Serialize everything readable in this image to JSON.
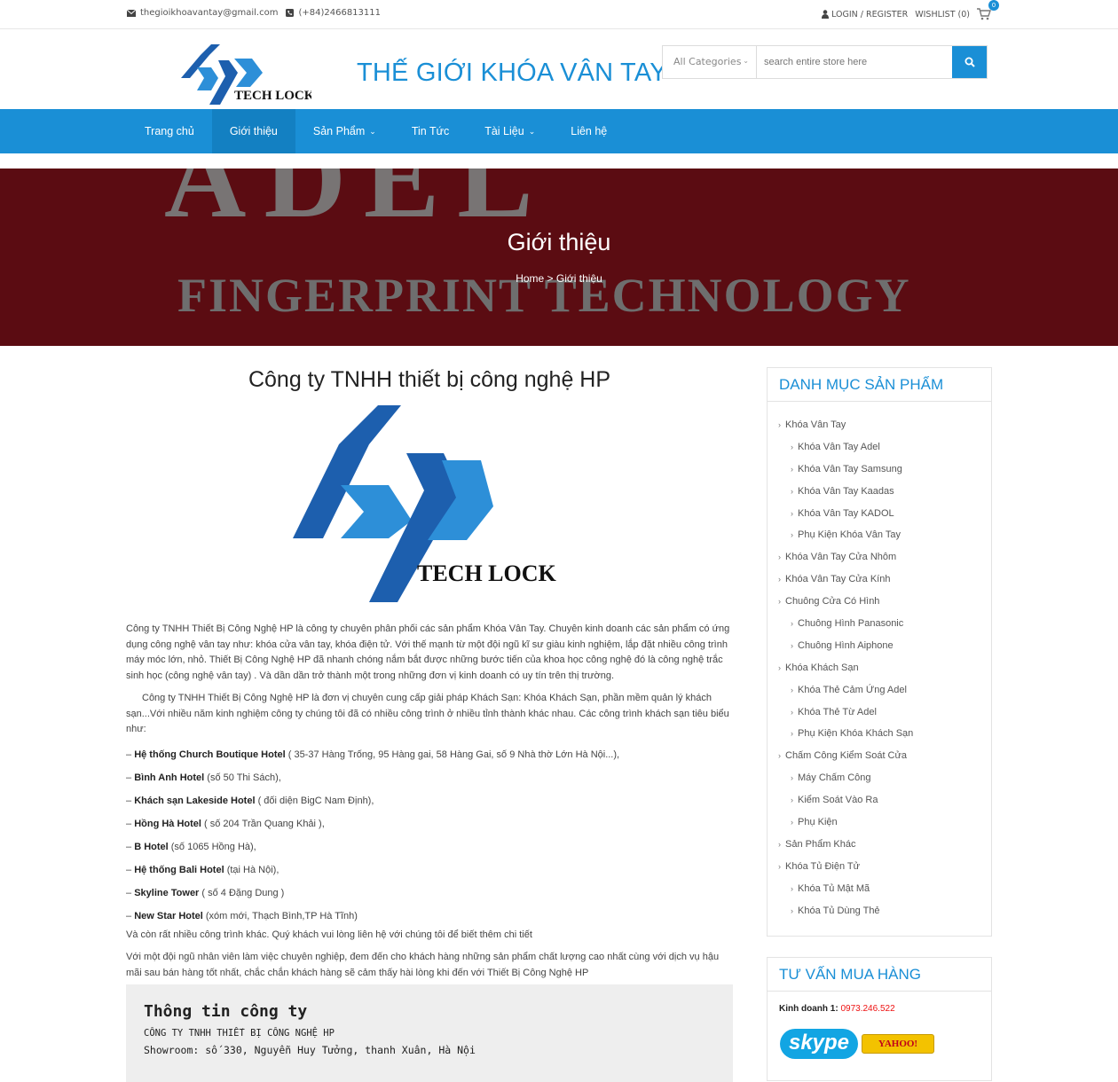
{
  "topbar": {
    "email": "thegioikhoavantay@gmail.com",
    "phone": "(+84)2466813111",
    "login": "LOGIN / REGISTER",
    "wishlist": "WISHLIST (0)",
    "cart_count": "0"
  },
  "header": {
    "logo_text": "TECH LOCK",
    "site_title": "THẾ GIỚI KHÓA VÂN TAY",
    "search_category": "All Categories",
    "search_placeholder": "search entire store here"
  },
  "nav": {
    "items": [
      "Trang chủ",
      "Giới thiệu",
      "Sản Phẩm",
      "Tin Tức",
      "Tài Liệu",
      "Liên hệ"
    ]
  },
  "banner": {
    "bg_text_1": "ADEL",
    "bg_text_2": "FINGERPRINT TECHNOLOGY",
    "title": "Giới thiệu",
    "crumb_home": "Home",
    "crumb_sep": " > ",
    "crumb_current": "Giới thiệu"
  },
  "content": {
    "heading": "Công ty TNHH thiết bị công nghệ HP",
    "logo_text": "TECH LOCK",
    "para1": "Công ty TNHH Thiết Bị Công Nghệ HP là công ty chuyên phân phối các sản phẩm Khóa Vân Tay. Chuyên kinh doanh các sản phẩm có ứng dụng công nghệ vân tay như: khóa cửa vân tay, khóa điện tử. Với thế mạnh từ một đội ngũ kĩ sư giàu kinh nghiệm, lắp đặt nhiều công trình máy móc lớn, nhỏ. Thiết Bị Công Nghệ HP đã nhanh chóng nắm bắt được những bước tiến của khoa học công nghệ đó là công nghệ trắc sinh học (công nghệ vân tay) . Và dần dần trở thành một trong những đơn vị kinh doanh có uy tín trên thị trường.",
    "para2": "Công ty TNHH Thiết Bị Công Nghệ HP là đơn vị chuyên cung cấp giải pháp Khách Sạn: Khóa Khách Sạn, phần mềm quản lý khách sạn...Với nhiều năm kinh nghiệm công ty chúng tôi đã có nhiều công trình ở nhiều tỉnh thành khác nhau. Các công trình khách sạn tiêu biểu như:",
    "hotels": [
      {
        "name": "Hệ thống Church Boutique Hotel",
        "detail": " ( 35-37 Hàng Trống, 95 Hàng gai, 58 Hàng Gai, số 9 Nhà thờ Lớn Hà Nội...),"
      },
      {
        "name": "Bình Anh Hotel",
        "detail": " (số 50 Thi Sách),"
      },
      {
        "name": "Khách sạn Lakeside Hotel",
        "detail": " ( đối diện BigC Nam Định),"
      },
      {
        "name": "Hồng Hà Hotel",
        "detail": " ( số 204 Trần Quang Khải ),"
      },
      {
        "name": "B Hotel",
        "detail": " (số 1065 Hồng Hà),"
      },
      {
        "name": "Hệ thống Bali Hotel",
        "detail": " (tại Hà Nội),"
      },
      {
        "name": "Skyline Tower",
        "detail": " ( số 4 Đặng Dung )"
      },
      {
        "name": "New Star Hotel",
        "detail": " (xóm mới, Thạch Bình,TP Hà Tĩnh)"
      }
    ],
    "para3": "Và còn rất nhiều công trình khác. Quý khách vui lòng liên hệ với chúng tôi để biết thêm chi tiết",
    "para4": "Với một đội ngũ nhân viên làm việc chuyên nghiệp, đem đến cho khách hàng những sản phẩm chất lượng cao nhất cùng với dịch vụ hậu mãi sau bán hàng tốt nhất, chắc chắn khách hàng sẽ cảm thấy hài lòng khi đến với Thiết Bị Công Nghệ HP",
    "info_title": "Thông tin công ty",
    "info_company": "CÔNG TY TNHH THIẾT BỊ CÔNG NGHỆ HP",
    "info_showroom": "Showroom: số 330, Nguyễn Huy Tưởng, thanh Xuân, Hà Nội"
  },
  "sidebar": {
    "categories_title": "DANH MỤC SẢN PHẨM",
    "categories": [
      {
        "label": "Khóa Vân Tay",
        "level": 0
      },
      {
        "label": "Khóa Vân Tay Adel",
        "level": 1
      },
      {
        "label": "Khóa Vân Tay Samsung",
        "level": 1
      },
      {
        "label": "Khóa Vân Tay Kaadas",
        "level": 1
      },
      {
        "label": "Khóa Vân Tay KADOL",
        "level": 1
      },
      {
        "label": "Phụ Kiện Khóa Vân Tay",
        "level": 1
      },
      {
        "label": "Khóa Vân Tay Cửa Nhôm",
        "level": 0
      },
      {
        "label": "Khóa Vân Tay Cửa Kính",
        "level": 0
      },
      {
        "label": "Chuông Cửa Có Hình",
        "level": 0
      },
      {
        "label": "Chuông Hình Panasonic",
        "level": 1
      },
      {
        "label": "Chuông Hình Aiphone",
        "level": 1
      },
      {
        "label": "Khóa Khách Sạn",
        "level": 0
      },
      {
        "label": "Khóa Thẻ Cảm Ứng Adel",
        "level": 1
      },
      {
        "label": "Khóa Thẻ Từ Adel",
        "level": 1
      },
      {
        "label": "Phụ Kiện Khóa Khách Sạn",
        "level": 1
      },
      {
        "label": "Chấm Công Kiểm Soát Cửa",
        "level": 0
      },
      {
        "label": "Máy Chấm Công",
        "level": 1
      },
      {
        "label": "Kiểm Soát Vào Ra",
        "level": 1
      },
      {
        "label": "Phụ Kiện",
        "level": 1
      },
      {
        "label": "Sản Phẩm Khác",
        "level": 0
      },
      {
        "label": "Khóa Tủ Điện Tử",
        "level": 0
      },
      {
        "label": "Khóa Tủ Mật Mã",
        "level": 1
      },
      {
        "label": "Khóa Tủ Dùng Thẻ",
        "level": 1
      }
    ],
    "advice_title": "TƯ VẤN MUA HÀNG",
    "sales_label": "Kinh doanh 1:",
    "sales_phone": "0973.246.522",
    "skype_label": "skype",
    "yahoo_label": "YAHOO!"
  },
  "colors": {
    "accent": "#1a8fd6",
    "banner_bg": "#5b0c12",
    "phone_red": "#ee1111"
  }
}
